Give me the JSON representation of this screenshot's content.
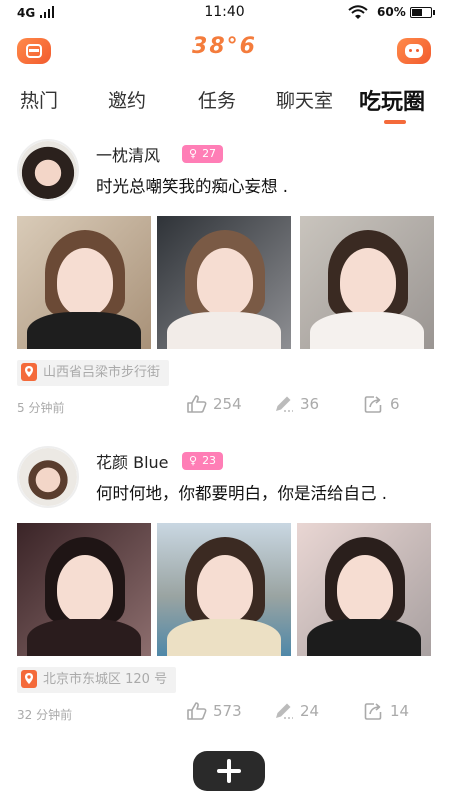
{
  "status_bar": {
    "carrier": "4G",
    "time": "11:40",
    "battery_percent": "60%",
    "battery_level": 0.6,
    "icons": [
      "signal-icon",
      "wifi-icon",
      "battery-icon"
    ]
  },
  "header": {
    "logo": "38°6",
    "left_icon": "menu-icon",
    "right_icon": "chat-icon",
    "accent_color": "#f46a3a"
  },
  "tabs": [
    {
      "label": "热门"
    },
    {
      "label": "邀约"
    },
    {
      "label": "任务"
    },
    {
      "label": "聊天室"
    },
    {
      "label": "吃玩圈",
      "active": true
    }
  ],
  "posts": [
    {
      "username": "一枕清风",
      "badge": "27",
      "text": "时光总嘲笑我的痴心妄想 .",
      "location": "山西省吕梁市步行街",
      "time_ago": "5 分钟前",
      "likes": "254",
      "comments": "36",
      "shares": "6"
    },
    {
      "username": "花颜 Blue",
      "badge": "23",
      "text": "何时何地，你都要明白，你是活给自己 .",
      "location": "北京市东城区 120 号",
      "time_ago": "32 分钟前",
      "likes": "573",
      "comments": "24",
      "shares": "14"
    }
  ],
  "fab": {
    "icon": "plus-icon"
  },
  "colors": {
    "badge": "#ff7eb6",
    "location_pin": "#f46a3a",
    "muted_text": "#aaaaaa"
  }
}
